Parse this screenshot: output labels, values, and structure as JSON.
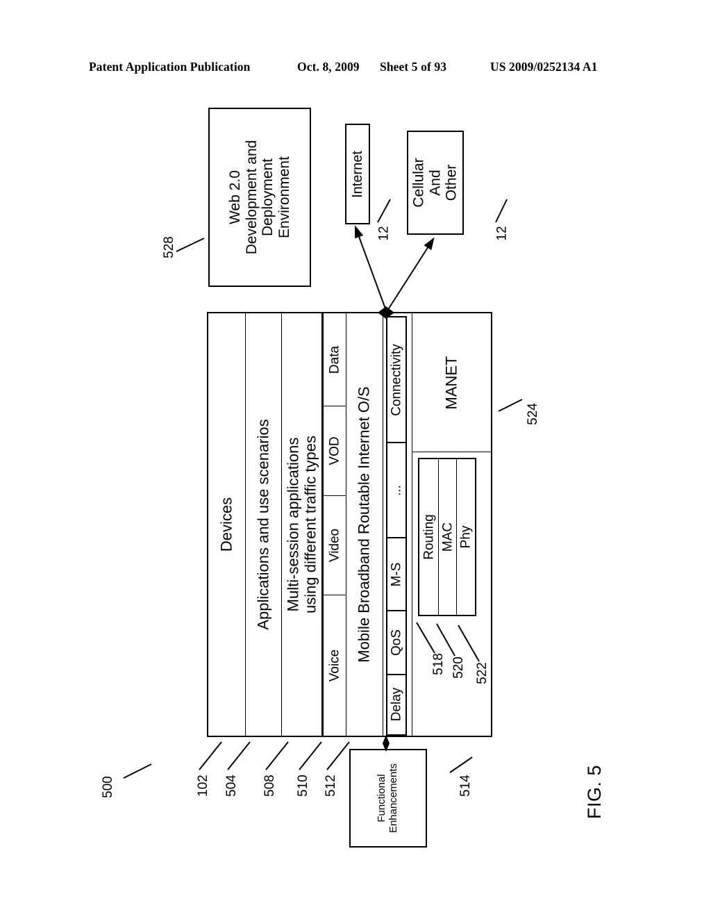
{
  "header": {
    "publication": "Patent Application Publication",
    "date": "Oct. 8, 2009",
    "sheet": "Sheet 5 of 93",
    "number": "US 2009/0252134 A1"
  },
  "figure": {
    "label": "FIG. 5",
    "diagram_ref": "500"
  },
  "boxes": {
    "web20": {
      "ref": "528",
      "lines": [
        "Web 2.0",
        "Development and",
        "Deployment",
        "Environment"
      ]
    },
    "internet": {
      "ref": "12",
      "label": "Internet"
    },
    "cellular": {
      "ref": "12",
      "lines": [
        "Cellular",
        "And",
        "Other"
      ]
    },
    "functional_enhancements": {
      "ref": "514",
      "lines": [
        "Functional",
        "Enhancements"
      ]
    }
  },
  "stack": {
    "rows": [
      {
        "ref": "102",
        "label": "Devices"
      },
      {
        "ref": "504",
        "label": "Applications and use scenarios"
      },
      {
        "ref": "508",
        "lines": [
          "Multi-session applications",
          "using different traffic types"
        ]
      },
      {
        "ref": "510",
        "traffic_types": [
          "Voice",
          "Video",
          "VOD",
          "Data"
        ]
      },
      {
        "ref": "",
        "label": "Mobile Broadband Routable Internet O/S"
      },
      {
        "ref": "512",
        "layers": [
          "Delay",
          "QoS",
          "M-S",
          "...",
          "Connectivity"
        ]
      }
    ],
    "manet": {
      "ref": "524",
      "label": "MANET",
      "sublayers": [
        {
          "ref": "518",
          "label": "Routing"
        },
        {
          "ref": "520",
          "label": "MAC"
        },
        {
          "ref": "522",
          "label": "Phy"
        }
      ]
    }
  },
  "colors": {
    "line": "#000000",
    "background": "#ffffff"
  }
}
